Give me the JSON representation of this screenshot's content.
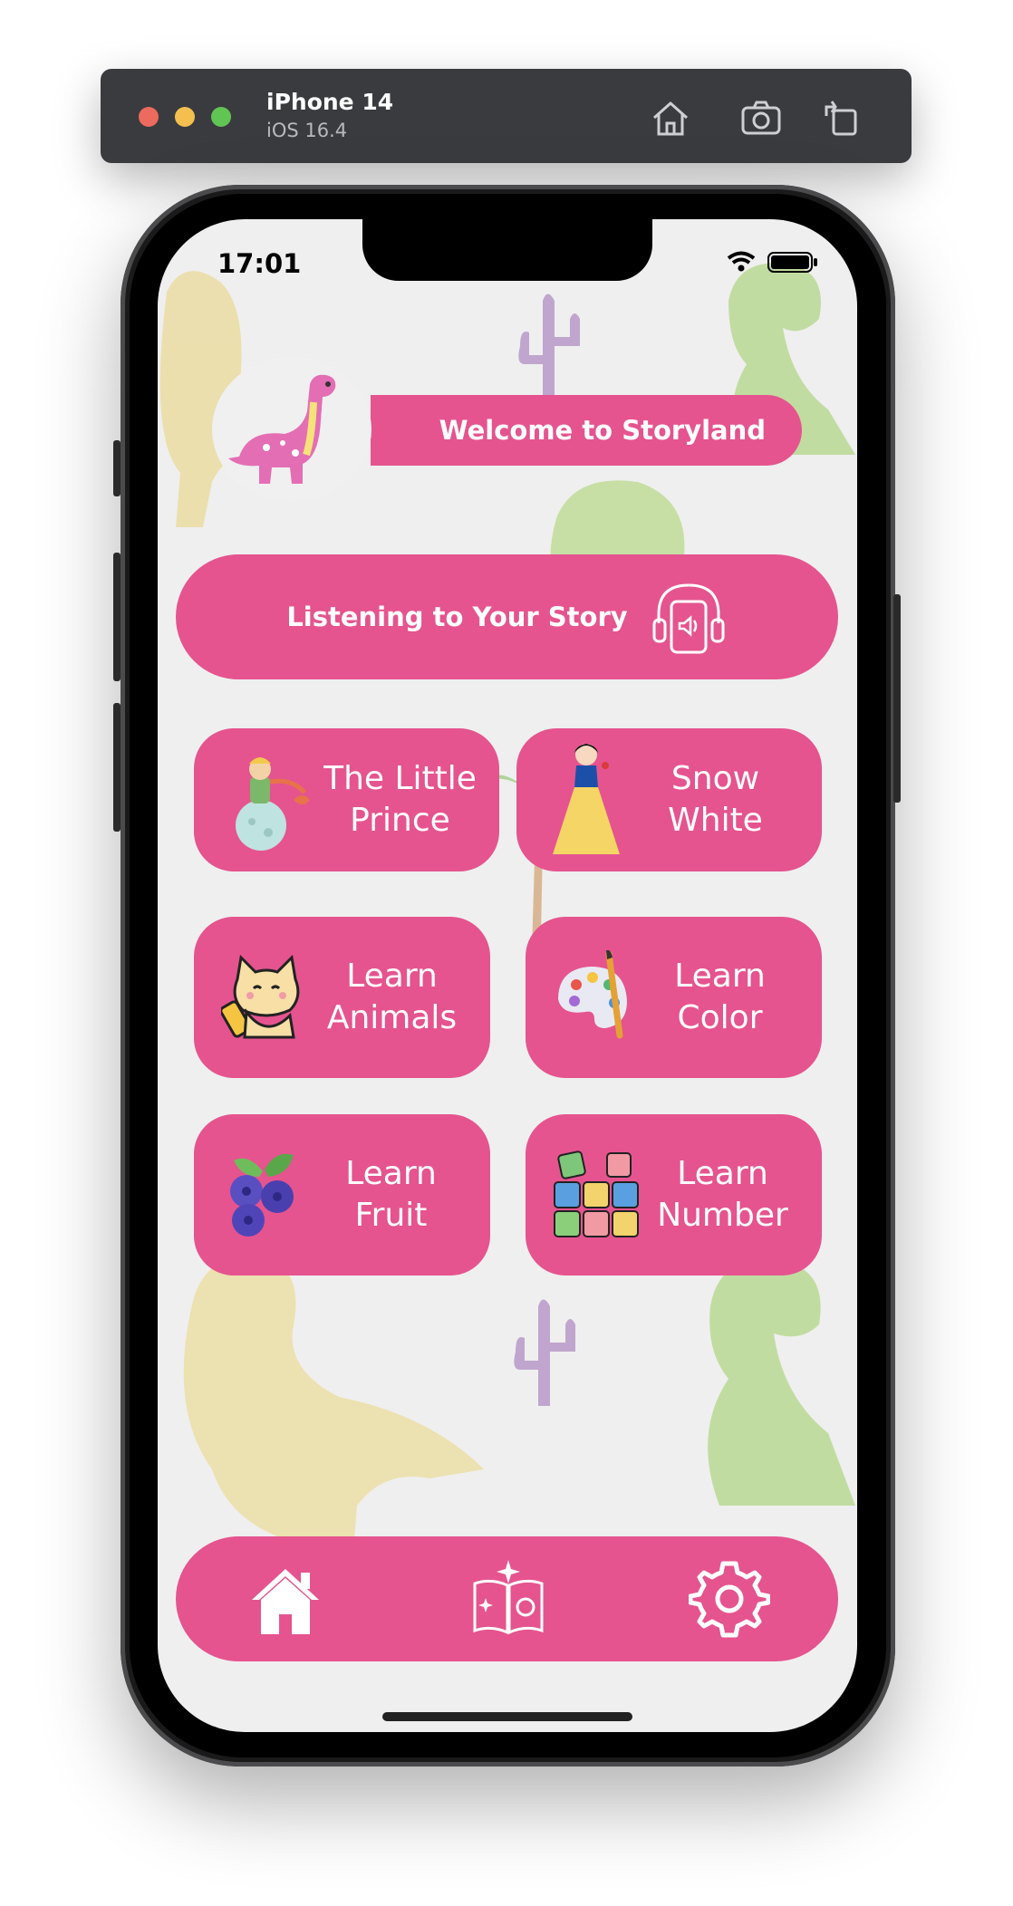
{
  "simulator": {
    "device_name": "iPhone 14",
    "os_version": "iOS 16.4",
    "buttons": [
      "home-icon",
      "screenshot-icon",
      "rotate-icon"
    ]
  },
  "status_bar": {
    "time": "17:01",
    "icons": [
      "wifi-icon",
      "battery-icon"
    ]
  },
  "header": {
    "welcome": "Welcome to Storyland",
    "avatar_icon": "dinosaur-avatar-icon"
  },
  "listen": {
    "label": "Listening to Your Story",
    "icon": "headphones-icon"
  },
  "cards": [
    {
      "label_line1": "The Little",
      "label_line2": "Prince",
      "icon": "little-prince-icon"
    },
    {
      "label_line1": "Snow",
      "label_line2": "White",
      "icon": "snow-white-icon"
    },
    {
      "label_line1": "Learn",
      "label_line2": "Animals",
      "icon": "cat-icon"
    },
    {
      "label_line1": "Learn",
      "label_line2": "Color",
      "icon": "palette-icon"
    },
    {
      "label_line1": "Learn Fruit",
      "icon": "blueberry-icon"
    },
    {
      "label_line1": "Learn",
      "label_line2": "Number",
      "icon": "number-blocks-icon"
    }
  ],
  "nav": {
    "items": [
      "home-icon",
      "storybook-icon",
      "settings-icon"
    ]
  },
  "colors": {
    "accent": "#e5548f",
    "background": "#efefef",
    "toolbar": "#3a3b3f"
  }
}
